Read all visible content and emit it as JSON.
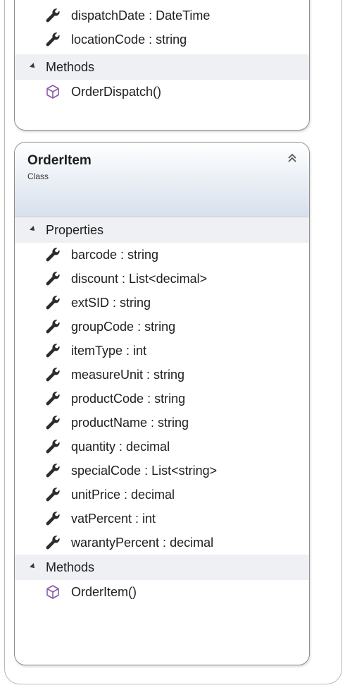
{
  "top_class": {
    "properties": [
      {
        "label": "dispatchDate : DateTime",
        "icon": "wrench-icon"
      },
      {
        "label": "locationCode : string",
        "icon": "wrench-icon"
      }
    ],
    "methods_label": "Methods",
    "methods": [
      {
        "label": "OrderDispatch()",
        "icon": "cube-icon"
      }
    ]
  },
  "main_class": {
    "title": "OrderItem",
    "subtitle": "Class",
    "properties_label": "Properties",
    "properties": [
      {
        "label": "barcode : string",
        "icon": "wrench-icon"
      },
      {
        "label": "discount : List<decimal>",
        "icon": "wrench-icon"
      },
      {
        "label": "extSID : string",
        "icon": "wrench-icon"
      },
      {
        "label": "groupCode : string",
        "icon": "wrench-icon"
      },
      {
        "label": "itemType : int",
        "icon": "wrench-icon"
      },
      {
        "label": "measureUnit : string",
        "icon": "wrench-icon"
      },
      {
        "label": "productCode : string",
        "icon": "wrench-icon"
      },
      {
        "label": "productName : string",
        "icon": "wrench-icon"
      },
      {
        "label": "quantity : decimal",
        "icon": "wrench-icon"
      },
      {
        "label": "specialCode : List<string>",
        "icon": "wrench-icon"
      },
      {
        "label": "unitPrice : decimal",
        "icon": "wrench-icon"
      },
      {
        "label": "vatPercent : int",
        "icon": "wrench-icon"
      },
      {
        "label": "warantyPercent : decimal",
        "icon": "wrench-icon"
      }
    ],
    "methods_label": "Methods",
    "methods": [
      {
        "label": "OrderItem()",
        "icon": "cube-icon"
      }
    ]
  },
  "colors": {
    "header_gradient_end": "#d7e0ec",
    "section_bg": "#eef0f3",
    "method_icon": "#8a5aa8"
  }
}
